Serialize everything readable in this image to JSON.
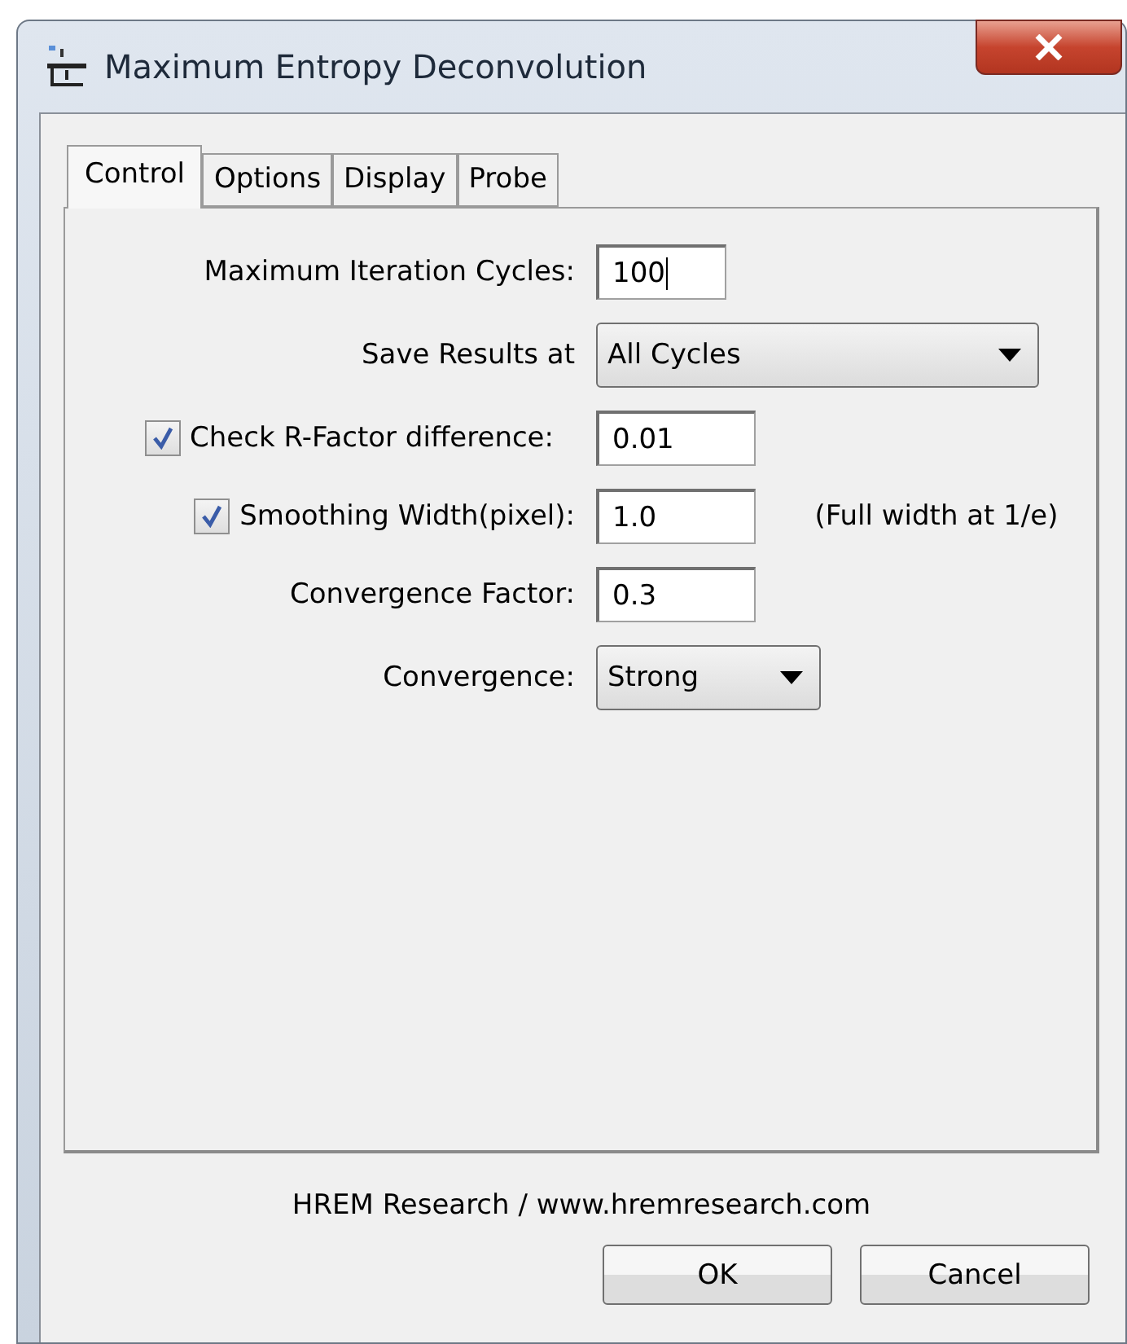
{
  "window": {
    "title": "Maximum Entropy Deconvolution"
  },
  "tabs": [
    {
      "label": "Control",
      "selected": true
    },
    {
      "label": "Options",
      "selected": false
    },
    {
      "label": "Display",
      "selected": false
    },
    {
      "label": "Probe",
      "selected": false
    }
  ],
  "fields": [
    {
      "kind": "text",
      "label": "Maximum Iteration Cycles:",
      "value": "100",
      "focused": true
    },
    {
      "kind": "select",
      "label": "Save Results at",
      "value": "All Cycles"
    },
    {
      "kind": "checkbox",
      "label": "Check R-Factor difference:",
      "checked": true,
      "value": "0.01"
    },
    {
      "kind": "checkbox",
      "label": "Smoothing Width(pixel):",
      "checked": true,
      "value": "1.0",
      "note": "(Full width at 1/e)"
    },
    {
      "kind": "text",
      "label": "Convergence Factor:",
      "value": "0.3"
    },
    {
      "kind": "select",
      "label": "Convergence:",
      "value": "Strong"
    }
  ],
  "footer": "HREM Research / www.hremresearch.com",
  "buttons": [
    "OK",
    "Cancel"
  ]
}
